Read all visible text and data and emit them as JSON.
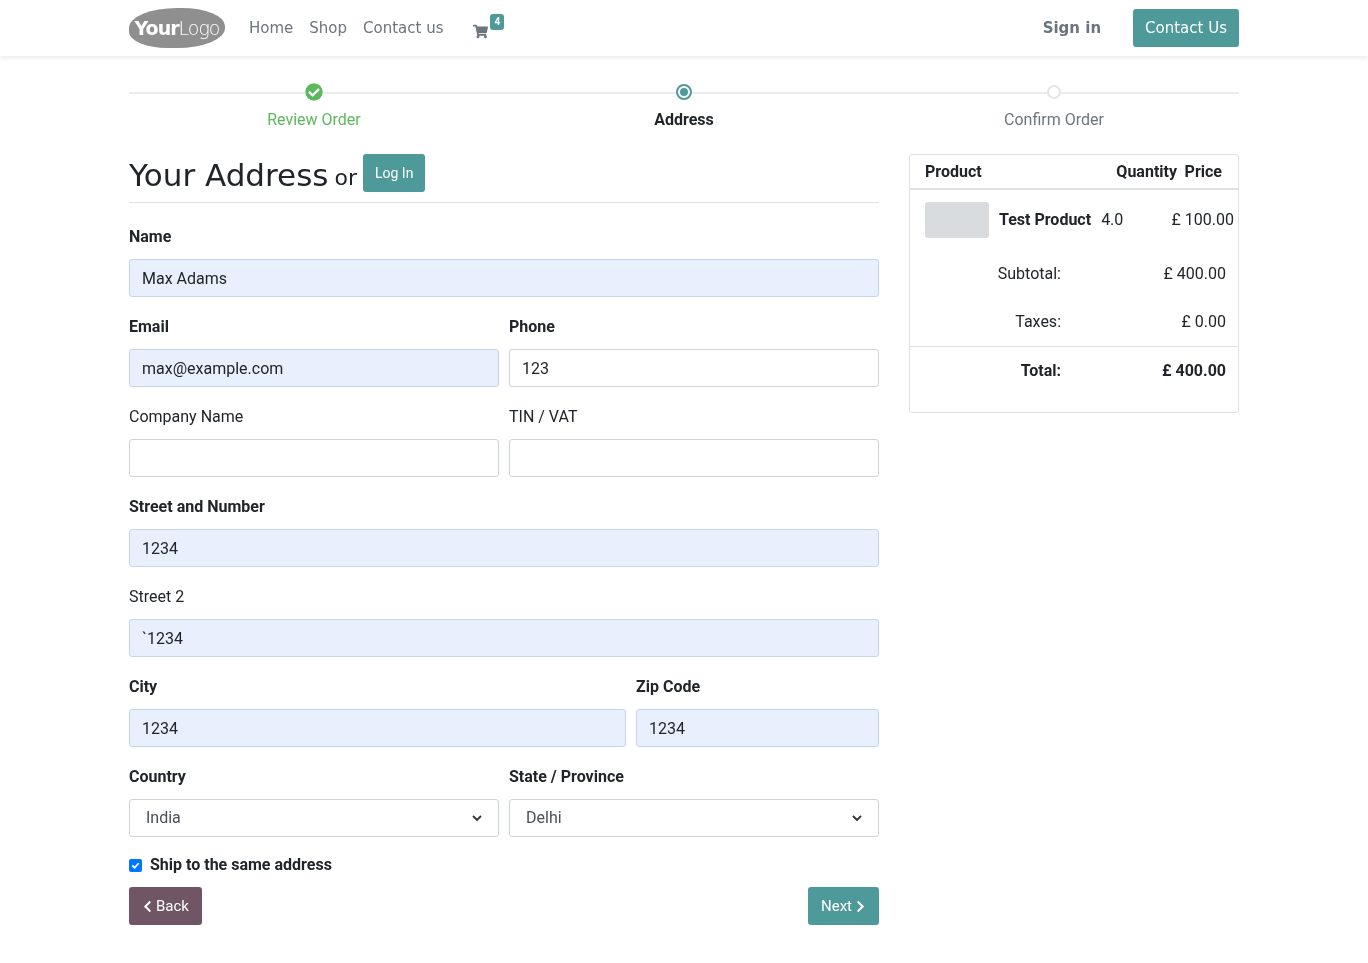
{
  "header": {
    "logo": {
      "bold": "Your",
      "light": "Logo"
    },
    "nav": [
      "Home",
      "Shop",
      "Contact us"
    ],
    "cart_count": "4",
    "sign_in": "Sign in",
    "contact_button": "Contact Us"
  },
  "steps": [
    {
      "label": "Review Order",
      "completed": true,
      "selected": false
    },
    {
      "label": "Address",
      "completed": false,
      "selected": true
    },
    {
      "label": "Confirm Order",
      "completed": false,
      "selected": false
    }
  ],
  "form": {
    "title": "Your Address",
    "or": "or",
    "login_button": "Log In",
    "rows": [
      {
        "kind": "full",
        "fields": [
          {
            "label": "Name",
            "required": true,
            "kind": "text",
            "value": "Max Adams",
            "autofilled": true
          }
        ]
      },
      {
        "kind": "even",
        "fields": [
          {
            "label": "Email",
            "required": true,
            "kind": "text",
            "value": "max@example.com",
            "autofilled": true
          },
          {
            "label": "Phone",
            "required": true,
            "kind": "text",
            "value": "123",
            "autofilled": false
          }
        ]
      },
      {
        "kind": "even",
        "fields": [
          {
            "label": "Company Name",
            "required": false,
            "kind": "text",
            "autofilled": false
          },
          {
            "label": "TIN / VAT",
            "required": false,
            "kind": "text",
            "autofilled": false
          }
        ]
      },
      {
        "kind": "full",
        "fields": [
          {
            "label": "Street and Number",
            "required": true,
            "kind": "text",
            "value": "1234",
            "autofilled": true
          }
        ]
      },
      {
        "kind": "full",
        "fields": [
          {
            "label": "Street 2",
            "required": false,
            "kind": "text",
            "value": "`1234",
            "autofilled": true
          }
        ]
      },
      {
        "kind": "wide_narrow",
        "fields": [
          {
            "label": "City",
            "required": true,
            "kind": "text",
            "value": "1234",
            "autofilled": true
          },
          {
            "label": "Zip Code",
            "required": true,
            "kind": "text",
            "value": "1234",
            "autofilled": true
          }
        ]
      },
      {
        "kind": "even",
        "fields": [
          {
            "label": "Country",
            "required": true,
            "kind": "select",
            "value": "India",
            "autofilled": false
          },
          {
            "label": "State / Province",
            "required": true,
            "kind": "select",
            "value": "Delhi",
            "autofilled": false
          }
        ]
      }
    ],
    "ship_same": {
      "label": "Ship to the same address",
      "checked": true
    },
    "back_button": "Back",
    "next_button": "Next"
  },
  "summary": {
    "columns": [
      "Product",
      "Quantity",
      "Price"
    ],
    "items": [
      {
        "name": "Test Product",
        "quantity": "4.0",
        "price": "£ 100.00"
      }
    ],
    "subtotal": {
      "label": "Subtotal:",
      "value": "£ 400.00"
    },
    "taxes": {
      "label": "Taxes:",
      "value": "£ 0.00"
    },
    "total": {
      "label": "Total:",
      "value": "£ 400.00"
    }
  }
}
